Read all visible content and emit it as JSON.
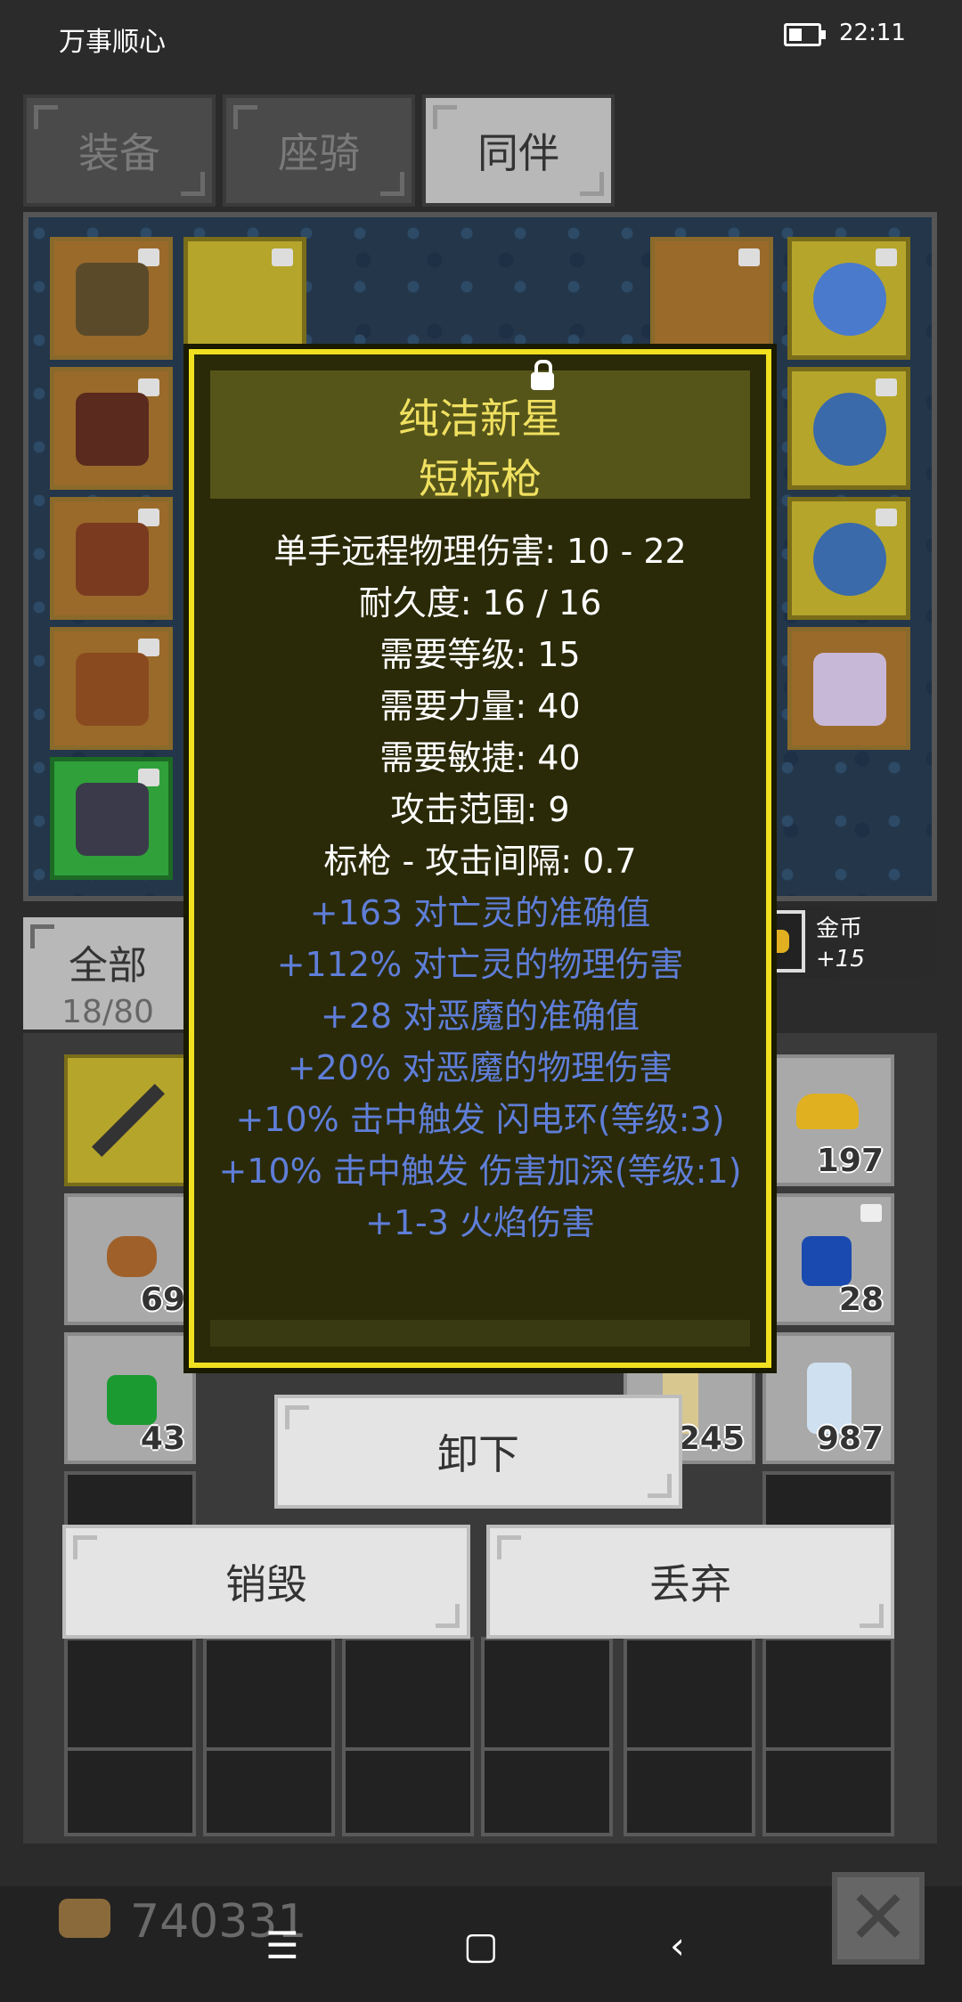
{
  "status_bar": {
    "carrier": "万事顺心",
    "time": "22:11"
  },
  "tabs": [
    {
      "label": "装备",
      "active": false
    },
    {
      "label": "座骑",
      "active": false
    },
    {
      "label": "同伴",
      "active": true
    }
  ],
  "category": {
    "label": "全部",
    "count": "18/80"
  },
  "tooltip": {
    "title_line1": "纯洁新星",
    "title_line2": "短标枪",
    "stats": [
      {
        "text": "单手远程物理伤害: 10 - 22",
        "color": "white"
      },
      {
        "text": "耐久度: 16 / 16",
        "color": "white"
      },
      {
        "text": "需要等级: 15",
        "color": "white"
      },
      {
        "text": "需要力量: 40",
        "color": "white"
      },
      {
        "text": "需要敏捷: 40",
        "color": "white"
      },
      {
        "text": "攻击范围: 9",
        "color": "white"
      },
      {
        "text": "标枪 - 攻击间隔: 0.7",
        "color": "white"
      },
      {
        "text": "+163 对亡灵的准确值",
        "color": "blue"
      },
      {
        "text": "+112% 对亡灵的物理伤害",
        "color": "blue"
      },
      {
        "text": "+28 对恶魔的准确值",
        "color": "blue"
      },
      {
        "text": "+20% 对恶魔的物理伤害",
        "color": "blue"
      },
      {
        "text": "+10% 击中触发 闪电环(等级:3)",
        "color": "blue"
      },
      {
        "text": "+10% 击中触发 伤害加深(等级:1)",
        "color": "blue"
      },
      {
        "text": "+1-3 火焰伤害",
        "color": "blue"
      }
    ]
  },
  "buttons": {
    "unequip": "卸下",
    "destroy": "销毁",
    "discard": "丢弃"
  },
  "gold_notice": {
    "title": "金币",
    "amount": "+15"
  },
  "inventory_counts": {
    "gold_pile": "197",
    "bread": "69",
    "blue_gem": "28",
    "green_gem": "43",
    "scroll": "245",
    "potion": "987"
  },
  "gold_total": "740331",
  "colors": {
    "tooltip_border": "#f0e020",
    "tooltip_title": "#f0e060",
    "affix_blue": "#5f7ed8"
  },
  "icons": [
    "lock-icon",
    "gold-coin-icon",
    "close-icon",
    "menu-icon",
    "home-icon",
    "back-icon"
  ]
}
